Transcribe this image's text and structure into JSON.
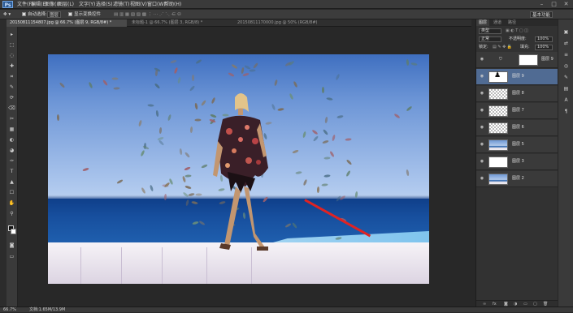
{
  "app": {
    "logo": "Ps"
  },
  "menubar": {
    "items": [
      "文件(F)",
      "编辑(E)",
      "图像(I)",
      "图层(L)",
      "文字(Y)",
      "选择(S)",
      "滤镜(T)",
      "视图(V)",
      "窗口(W)",
      "帮助(H)"
    ],
    "window_buttons": [
      "–",
      "□",
      "✕"
    ]
  },
  "options_bar": {
    "move_icon": "move-icon",
    "auto_select_label": "自动选择:",
    "auto_select_value": "图层",
    "show_transform_label": "显示变换控件",
    "workspace_label": "基本功能"
  },
  "tabs": [
    {
      "label": "20150811154807.jpg @ 66.7% (图层 9, RGB/8#) *",
      "active": true
    },
    {
      "label": "未标题-1 @ 66.7% (图层 3, RGB/8) *",
      "active": false
    },
    {
      "label": "20150811170000.jpg @ 50% (RGB/8#)",
      "active": false
    }
  ],
  "tools": [
    "▸",
    "⬚",
    "◌",
    "✚",
    "⌗",
    "✎",
    "⟳",
    "⌫",
    "✂",
    "▦",
    "◐",
    "◕",
    "✑",
    "T",
    "▲",
    "☐",
    "✋",
    "⚲"
  ],
  "status_bar": {
    "zoom": "66.7%",
    "doc_info": "文档:1.65M/13.9M"
  },
  "panel": {
    "tabs": [
      "图层",
      "通道",
      "路径"
    ],
    "kind_label": "类型",
    "blend_mode": "正常",
    "opacity_label": "不透明度:",
    "opacity_value": "100%",
    "lock_label": "锁定:",
    "fill_label": "填充:",
    "fill_value": "100%",
    "layers": [
      {
        "name": "图层 9",
        "thumb": "white",
        "selected": false
      },
      {
        "name": "图层 9",
        "thumb": "figure",
        "selected": true
      },
      {
        "name": "图层 8",
        "thumb": "transparent",
        "selected": false
      },
      {
        "name": "图层 7",
        "thumb": "transparent",
        "selected": false
      },
      {
        "name": "图层 6",
        "thumb": "transparent",
        "selected": false
      },
      {
        "name": "图层 5",
        "thumb": "photo",
        "selected": false
      },
      {
        "name": "图层 3",
        "thumb": "white",
        "selected": false
      },
      {
        "name": "图层 2",
        "thumb": "photo",
        "selected": false
      }
    ],
    "footer_icons": [
      "link-icon",
      "fx-icon",
      "mask-icon",
      "adjustment-icon",
      "folder-icon",
      "new-layer-icon",
      "trash-icon"
    ]
  },
  "dock": [
    "▣",
    "⇄",
    "≡",
    "◎",
    "✎",
    "▤",
    "A",
    "¶"
  ],
  "colors": {
    "accent": "#506b93",
    "arrow": "#e02323"
  }
}
